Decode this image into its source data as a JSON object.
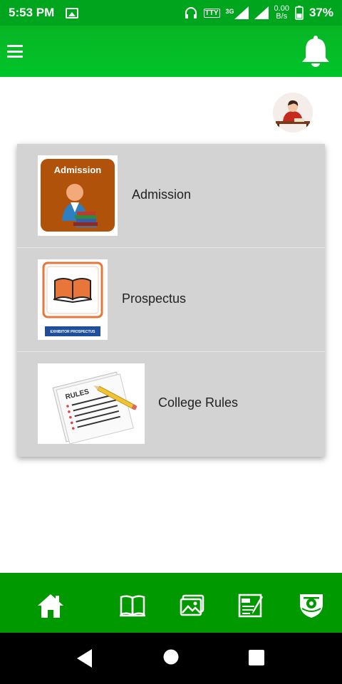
{
  "status_bar": {
    "time": "5:53 PM",
    "tty": "TTY",
    "network_type": "3G",
    "data_speed_value": "0.00",
    "data_speed_unit": "B/s",
    "battery": "37%"
  },
  "app_bar": {
    "menu_icon": "hamburger-menu-icon",
    "notification_icon": "bell-icon"
  },
  "menu_items": [
    {
      "label": "Admission",
      "thumb_text": "Admission"
    },
    {
      "label": "Prospectus",
      "thumb_text": "EXHIBITOR PROSPECTUS"
    },
    {
      "label": "College Rules",
      "thumb_text": "RULES"
    }
  ],
  "bottom_nav": [
    "home-icon",
    "book-icon",
    "gallery-icon",
    "exam-icon",
    "emblem-icon"
  ],
  "colors": {
    "status_bar": "#00a51e",
    "app_bar": "#00c42a",
    "bottom_nav": "#009a00",
    "card": "#d3d3d3"
  }
}
